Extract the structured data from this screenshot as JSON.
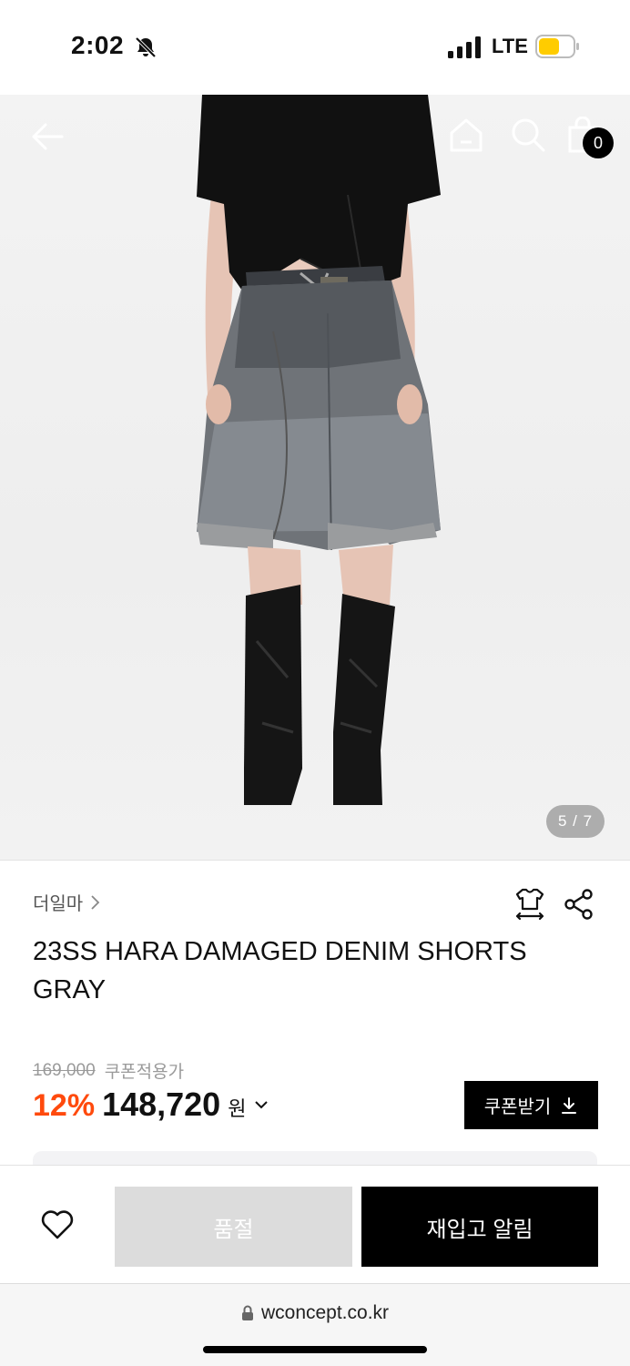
{
  "status_bar": {
    "time": "2:02",
    "network": "LTE"
  },
  "header": {
    "cart_count": "0"
  },
  "gallery": {
    "pager": "5 / 7"
  },
  "product": {
    "brand": "더일마",
    "title": "23SS HARA DAMAGED DENIM SHORTS GRAY",
    "original_price": "169,000",
    "coupon_note": "쿠폰적용가",
    "discount": "12%",
    "sale_price": "148,720",
    "currency": "원",
    "coupon_button": "쿠폰받기"
  },
  "actions": {
    "soldout_label": "품절",
    "restock_label": "재입고 알림"
  },
  "browser": {
    "url": "wconcept.co.kr"
  },
  "colors": {
    "discount": "#ff4a0d",
    "primary_button": "#000000",
    "disabled_button": "#dcdcdc"
  }
}
